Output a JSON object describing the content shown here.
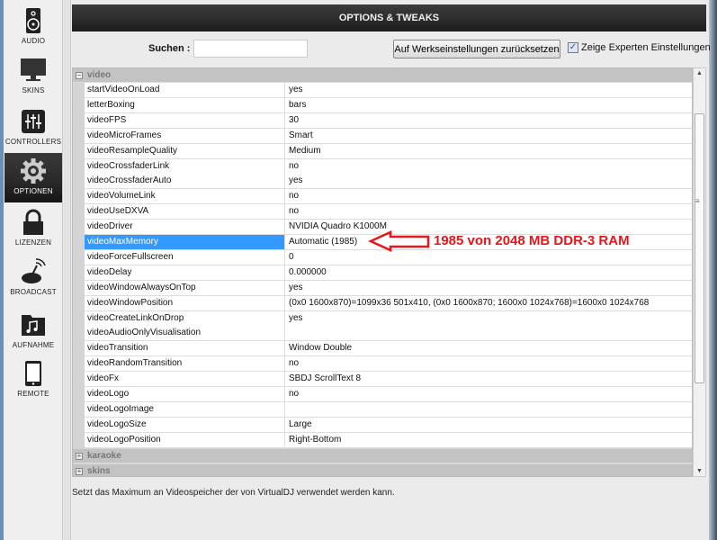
{
  "sidebar": {
    "items": [
      {
        "label": "AUDIO",
        "icon": "speaker-icon"
      },
      {
        "label": "SKINS",
        "icon": "monitor-icon"
      },
      {
        "label": "CONTROLLERS",
        "icon": "sliders-icon"
      },
      {
        "label": "OPTIONEN",
        "icon": "gear-icon",
        "selected": true
      },
      {
        "label": "LIZENZEN",
        "icon": "lock-icon"
      },
      {
        "label": "BROADCAST",
        "icon": "broadcast-icon"
      },
      {
        "label": "AUFNAHME",
        "icon": "music-folder-icon"
      },
      {
        "label": "REMOTE",
        "icon": "tablet-icon"
      }
    ]
  },
  "header": {
    "title": "OPTIONS & TWEAKS"
  },
  "toolbar": {
    "search_label": "Suchen :",
    "search_value": "",
    "reset_label": "Auf Werkseinstellungen zurücksetzen",
    "expert_label": "Zeige Experten Einstellungen",
    "expert_checked": true
  },
  "groups": {
    "video": "video",
    "karaoke": "karaoke",
    "skins": "skins"
  },
  "rows": [
    {
      "k": "startVideoOnLoad",
      "v": "yes"
    },
    {
      "k": "letterBoxing",
      "v": "bars"
    },
    {
      "k": "videoFPS",
      "v": "30"
    },
    {
      "k": "videoMicroFrames",
      "v": "Smart"
    },
    {
      "k": "videoResampleQuality",
      "v": "Medium"
    },
    {
      "k": "videoCrossfaderLink",
      "v": "no"
    },
    {
      "k": "videoCrossfaderAuto",
      "v": "yes"
    },
    {
      "k": "videoVolumeLink",
      "v": "no"
    },
    {
      "k": "videoUseDXVA",
      "v": "no"
    },
    {
      "k": "videoDriver",
      "v": "NVIDIA Quadro K1000M"
    },
    {
      "k": "videoMaxMemory",
      "v": "Automatic (1985)"
    },
    {
      "k": "videoForceFullscreen",
      "v": "0"
    },
    {
      "k": "videoDelay",
      "v": "0.000000"
    },
    {
      "k": "videoWindowAlwaysOnTop",
      "v": "yes"
    },
    {
      "k": "videoWindowPosition",
      "v": "(0x0 1600x870)=1099x36 501x410, (0x0 1600x870; 1600x0 1024x768)=1600x0 1024x768"
    },
    {
      "k": "videoCreateLinkOnDrop",
      "v": "yes"
    },
    {
      "k": "videoAudioOnlyVisualisation",
      "v": ""
    },
    {
      "k": "videoTransition",
      "v": "Window Double"
    },
    {
      "k": "videoRandomTransition",
      "v": "no"
    },
    {
      "k": "videoFx",
      "v": "SBDJ ScrollText 8"
    },
    {
      "k": "videoLogo",
      "v": "no"
    },
    {
      "k": "videoLogoImage",
      "v": ""
    },
    {
      "k": "videoLogoSize",
      "v": "Large"
    },
    {
      "k": "videoLogoPosition",
      "v": "Right-Bottom"
    }
  ],
  "annotation": "1985 von 2048 MB DDR-3 RAM",
  "footer": "Setzt das Maximum an Videospeicher der von VirtualDJ verwendet werden kann.",
  "colors": {
    "selection": "#3399ff",
    "annotation": "#e8151b"
  }
}
